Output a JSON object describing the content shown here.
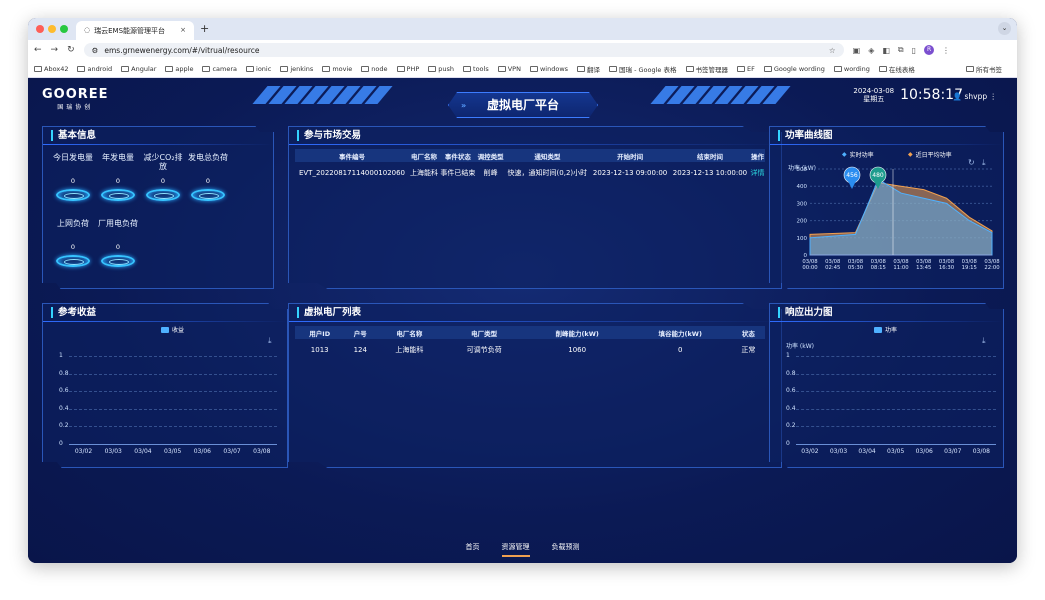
{
  "browser": {
    "tab_title": "瑞云EMS能源管理平台",
    "url": "ems.grnewenergy.com/#/vitrual/resource",
    "bookmarks": [
      "Abox42",
      "android",
      "Angular",
      "apple",
      "camera",
      "ionic",
      "jenkins",
      "movie",
      "node",
      "PHP",
      "push",
      "tools",
      "VPN",
      "windows",
      "翻译",
      "国瑞 - Google 表格",
      "书签管理器",
      "EF",
      "Google wording",
      "wording",
      "在线表格"
    ],
    "all_bookmarks": "所有书签",
    "profile_initial": "R"
  },
  "header": {
    "logo": "GOOREE",
    "logo_sub": "国瑞协创",
    "title": "虚拟电厂平台",
    "date": "2024-03-08",
    "weekday": "星期五",
    "time": "10:58:17",
    "user": "shvpp"
  },
  "basic": {
    "title": "基本信息",
    "stats": [
      {
        "label": "今日发电量",
        "value": "0"
      },
      {
        "label": "年发电量",
        "value": "0"
      },
      {
        "label": "减少CO₂排放",
        "value": "0"
      },
      {
        "label": "发电总负荷",
        "value": "0"
      },
      {
        "label": "上网负荷",
        "value": "0"
      },
      {
        "label": "厂用电负荷",
        "value": "0"
      }
    ]
  },
  "market": {
    "title": "参与市场交易",
    "columns": [
      "事件编号",
      "电厂名称",
      "事件状态",
      "调控类型",
      "通知类型",
      "开始时间",
      "结束时间",
      "操作"
    ],
    "rows": [
      {
        "id": "EVT_20220817114000102060",
        "plant": "上海能科",
        "status": "事件已结束",
        "ctrl": "削峰",
        "notify": "快速，通知时间(0,2)小时",
        "start": "2023-12-13 09:00:00",
        "end": "2023-12-13 10:00:00",
        "op": "详情"
      }
    ]
  },
  "power": {
    "title": "功率曲线图",
    "legend": [
      "实时功率",
      "近日平均功率"
    ],
    "unit": "功率 (kW)",
    "yticks": [
      "500",
      "400",
      "300",
      "200",
      "100",
      "0"
    ],
    "xticks": [
      "03/08 00:00",
      "03/08 02:45",
      "03/08 05:30",
      "03/08 08:15",
      "03/08 11:00",
      "03/08 13:45",
      "03/08 16:30",
      "03/08 19:15",
      "03/08 22:00"
    ],
    "bubbles": [
      "456",
      "480"
    ]
  },
  "income": {
    "title": "参考收益",
    "legend": "收益",
    "yticks": [
      "1",
      "0.8",
      "0.6",
      "0.4",
      "0.2",
      "0"
    ],
    "xticks": [
      "03/02",
      "03/03",
      "03/04",
      "03/05",
      "03/06",
      "03/07",
      "03/08"
    ]
  },
  "vpp": {
    "title": "虚拟电厂列表",
    "columns": [
      "用户ID",
      "户号",
      "电厂名称",
      "电厂类型",
      "削峰能力(kW)",
      "填谷能力(kW)",
      "状态"
    ],
    "rows": [
      {
        "uid": "1013",
        "no": "124",
        "name": "上海能科",
        "type": "可调节负荷",
        "peak": "1060",
        "valley": "0",
        "state": "正常"
      }
    ]
  },
  "response": {
    "title": "响应出力图",
    "legend": "功率",
    "unit": "功率 (kW)",
    "yticks": [
      "1",
      "0.8",
      "0.6",
      "0.4",
      "0.2",
      "0"
    ],
    "xticks": [
      "03/02",
      "03/03",
      "03/04",
      "03/05",
      "03/06",
      "03/07",
      "03/08"
    ]
  },
  "nav": [
    "首页",
    "资源管理",
    "负载预测"
  ],
  "chart_data": [
    {
      "type": "area",
      "title": "功率曲线图",
      "ylabel": "功率 (kW)",
      "ylim": [
        0,
        500
      ],
      "x": [
        "00:00",
        "02:45",
        "05:30",
        "08:15",
        "11:00",
        "13:45",
        "16:30",
        "19:15",
        "22:00"
      ],
      "series": [
        {
          "name": "实时功率",
          "values": [
            100,
            110,
            120,
            440,
            360,
            330,
            300,
            200,
            130
          ]
        },
        {
          "name": "近日平均功率",
          "values": [
            120,
            125,
            130,
            420,
            400,
            380,
            330,
            220,
            140
          ]
        }
      ]
    },
    {
      "type": "line",
      "title": "参考收益",
      "ylim": [
        0,
        1
      ],
      "categories": [
        "03/02",
        "03/03",
        "03/04",
        "03/05",
        "03/06",
        "03/07",
        "03/08"
      ],
      "series": [
        {
          "name": "收益",
          "values": []
        }
      ]
    },
    {
      "type": "line",
      "title": "响应出力图",
      "ylabel": "功率 (kW)",
      "ylim": [
        0,
        1
      ],
      "categories": [
        "03/02",
        "03/03",
        "03/04",
        "03/05",
        "03/06",
        "03/07",
        "03/08"
      ],
      "series": [
        {
          "name": "功率",
          "values": []
        }
      ]
    }
  ]
}
